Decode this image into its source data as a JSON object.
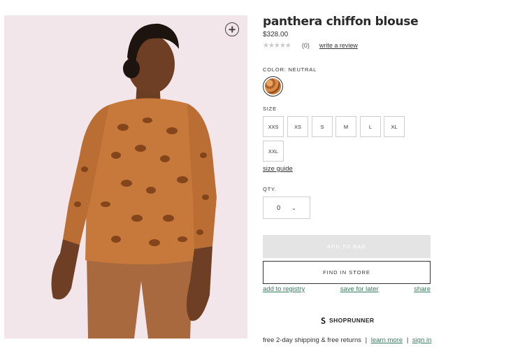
{
  "product": {
    "title": "panthera chiffon blouse",
    "price": "$328.00",
    "stars": "★★★★★",
    "rating_count": "(0)",
    "write_review": "write a review"
  },
  "color": {
    "label": "COLOR: NEUTRAL"
  },
  "size": {
    "label": "SIZE",
    "options": [
      "XXS",
      "XS",
      "S",
      "M",
      "L",
      "XL",
      "XXL"
    ],
    "guide": "size guide"
  },
  "quantity": {
    "label": "QTY.",
    "value": "0",
    "chevron": "⌄"
  },
  "actions": {
    "add_to_bag": "ADD TO BAG",
    "find_in_store": "FIND IN STORE",
    "add_to_registry": "add to registry",
    "save_for_later": "save for later",
    "share": "share"
  },
  "shoprunner": {
    "icon": "shoprunner-icon",
    "label": "SHOPRUNNER"
  },
  "shipping": {
    "text": "free 2-day shipping & free returns",
    "separator": "|",
    "learn_more": "learn more",
    "sign_in": "sign in"
  },
  "icons": {
    "zoom": "zoom-plus-icon"
  },
  "colors": {
    "accent_link": "#3a7a5e",
    "image_bg": "#f2e6ea",
    "disabled_button": "#e4e4e4"
  }
}
